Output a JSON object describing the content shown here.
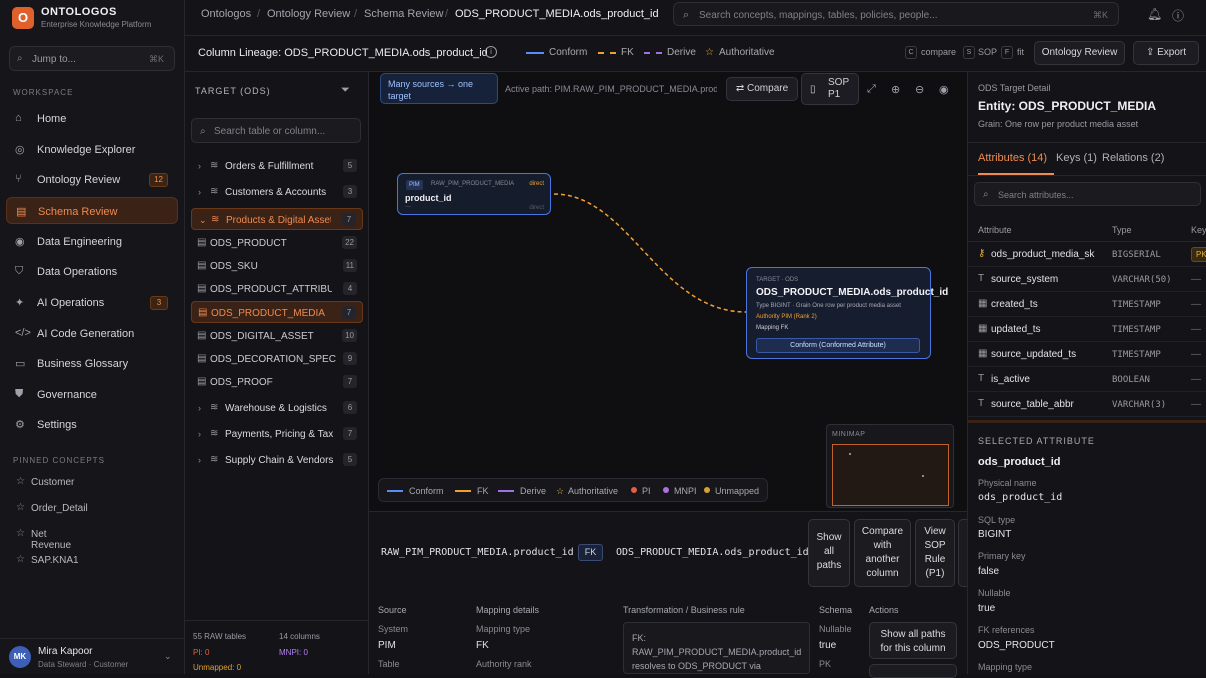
{
  "app": {
    "name": "ONTOLOGOS",
    "subtitle": "Enterprise Knowledge Platform",
    "logo_glyph": "O"
  },
  "jump": {
    "label": "Jump to...",
    "shortcut": "⌘K"
  },
  "sidebar": {
    "workspace_label": "WORKSPACE",
    "items": [
      {
        "label": "Home",
        "icon": "home-icon"
      },
      {
        "label": "Knowledge Explorer",
        "icon": "compass-icon"
      },
      {
        "label": "Ontology Review",
        "icon": "graph-icon",
        "badge": "12"
      },
      {
        "label": "Schema Review",
        "icon": "table-icon",
        "active": true
      },
      {
        "label": "Data Engineering",
        "icon": "database-icon"
      },
      {
        "label": "Data Operations",
        "icon": "shield-icon"
      },
      {
        "label": "AI Operations",
        "icon": "sparkle-icon",
        "badge": "3"
      },
      {
        "label": "AI Code Generation",
        "icon": "code-icon"
      },
      {
        "label": "Business Glossary",
        "icon": "book-icon"
      },
      {
        "label": "Governance",
        "icon": "shield-check-icon"
      },
      {
        "label": "Settings",
        "icon": "gear-icon"
      }
    ],
    "pinned_label": "PINNED CONCEPTS",
    "pinned": [
      "Customer",
      "Order_Detail",
      "Net Revenue",
      "SAP.KNA1"
    ]
  },
  "user": {
    "initials": "MK",
    "name": "Mira Kapoor",
    "role": "Data Steward · Customer"
  },
  "breadcrumb": [
    "Ontologos",
    "Ontology Review",
    "Schema Review",
    "ODS_PRODUCT_MEDIA.ods_product_id"
  ],
  "search": {
    "placeholder": "Search concepts, mappings, tables, policies, people...",
    "shortcut": "⌘K"
  },
  "lineage_header": {
    "title": "Column Lineage: ODS_PRODUCT_MEDIA.ods_product_id",
    "legend": [
      "Conform",
      "FK",
      "Derive",
      "Authoritative"
    ],
    "shortcuts": [
      {
        "key": "C",
        "label": "compare"
      },
      {
        "key": "S",
        "label": "SOP"
      },
      {
        "key": "F",
        "label": "fit"
      }
    ],
    "buttons": [
      "Ontology Review",
      "Export"
    ]
  },
  "tree": {
    "header": "TARGET (ODS)",
    "search_placeholder": "Search table or column...",
    "groups": [
      {
        "label": "Orders & Fulfillment",
        "count": "5"
      },
      {
        "label": "Customers & Accounts",
        "count": "3"
      },
      {
        "label": "Products & Digital Assets",
        "count": "7",
        "expanded": true
      }
    ],
    "tables": [
      {
        "label": "ODS_PRODUCT",
        "count": "22"
      },
      {
        "label": "ODS_SKU",
        "count": "11"
      },
      {
        "label": "ODS_PRODUCT_ATTRIBUTE",
        "count": "4"
      },
      {
        "label": "ODS_PRODUCT_MEDIA",
        "count": "7",
        "selected": true
      },
      {
        "label": "ODS_DIGITAL_ASSET",
        "count": "10"
      },
      {
        "label": "ODS_DECORATION_SPEC",
        "count": "9"
      },
      {
        "label": "ODS_PROOF",
        "count": "7"
      }
    ],
    "groups_after": [
      {
        "label": "Warehouse & Logistics",
        "count": "6"
      },
      {
        "label": "Payments, Pricing & Tax",
        "count": "7"
      },
      {
        "label": "Supply Chain & Vendors",
        "count": "5"
      }
    ],
    "stats": {
      "raw_tables": "55 RAW tables",
      "columns": "14 columns",
      "pi": "PI: 0",
      "mnpi": "MNPI: 0",
      "unmapped": "Unmapped: 0"
    }
  },
  "canvas": {
    "tooltip": "Many sources → one target",
    "active_path": "Active path: PIM.RAW_PIM_PRODUCT_MEDIA.product_id",
    "compare_label": "Compare",
    "sop_label": "SOP P1",
    "source_node": {
      "system": "PIM",
      "table": "RAW_PIM_PRODUCT_MEDIA",
      "column": "product_id",
      "tag": "direct",
      "sub": "direct",
      "dash": "—"
    },
    "target_node": {
      "eyebrow": "TARGET · ODS",
      "title": "ODS_PRODUCT_MEDIA.ods_product_id",
      "line1": "Type BIGINT · Grain One row per product media asset",
      "line2": "Authority PIM (Rank 2)",
      "line3": "Mapping FK",
      "button": "Conform (Conformed Attribute)"
    },
    "minimap_label": "MINIMAP",
    "legend": [
      {
        "label": "Conform",
        "color": "#5b8cf5"
      },
      {
        "label": "FK",
        "color": "#f0a030"
      },
      {
        "label": "Derive",
        "color": "#a070e8"
      },
      {
        "label": "Authoritative",
        "color": "#e0b040"
      },
      {
        "label": "PI",
        "color": "#e06040"
      },
      {
        "label": "MNPI",
        "color": "#b070e0"
      },
      {
        "label": "Unmapped",
        "color": "#d8a030"
      }
    ]
  },
  "detail": {
    "source_col": "RAW_PIM_PRODUCT_MEDIA.product_id",
    "rel": "FK",
    "target_col": "ODS_PRODUCT_MEDIA.ods_product_id",
    "buttons": [
      "Show all paths",
      "Compare with another column",
      "View SOP Rule (P1)"
    ],
    "cols": {
      "source": "Source",
      "system_l": "System",
      "system_v": "PIM",
      "table_l": "Table",
      "mapping": "Mapping details",
      "mtype_l": "Mapping type",
      "mtype_v": "FK",
      "arank_l": "Authority rank",
      "transform": "Transformation / Business rule",
      "transform_text": "FK: RAW_PIM_PRODUCT_MEDIA.product_id resolves to ODS_PRODUCT via",
      "schema": "Schema",
      "nullable_l": "Nullable",
      "nullable_v": "true",
      "pk_l": "PK",
      "actions": "Actions",
      "action_btn": "Show all paths for this column"
    }
  },
  "rpanel": {
    "eyebrow": "ODS Target Detail",
    "entity": "Entity: ODS_PRODUCT_MEDIA",
    "grain": "Grain: One row per product media asset",
    "tabs": [
      "Attributes (14)",
      "Keys (1)",
      "Relations (2)"
    ],
    "search_placeholder": "Search attributes...",
    "cols": [
      "Attribute",
      "Type",
      "Key"
    ],
    "rows": [
      {
        "name": "ods_product_media_sk",
        "type": "BIGSERIAL",
        "key": "PK",
        "icon": "key-icon"
      },
      {
        "name": "source_system",
        "type": "VARCHAR(50)",
        "key": "—",
        "icon": "text-icon"
      },
      {
        "name": "created_ts",
        "type": "TIMESTAMP",
        "key": "—",
        "icon": "calendar-icon"
      },
      {
        "name": "updated_ts",
        "type": "TIMESTAMP",
        "key": "—",
        "icon": "calendar-icon"
      },
      {
        "name": "source_updated_ts",
        "type": "TIMESTAMP",
        "key": "—",
        "icon": "calendar-icon"
      },
      {
        "name": "is_active",
        "type": "BOOLEAN",
        "key": "—",
        "icon": "text-icon"
      },
      {
        "name": "source_table_abbr",
        "type": "VARCHAR(3)",
        "key": "—",
        "icon": "text-icon"
      }
    ],
    "selected": {
      "header": "SELECTED ATTRIBUTE",
      "name": "ods_product_id",
      "fields": [
        {
          "label": "Physical name",
          "value": "ods_product_id"
        },
        {
          "label": "SQL type",
          "value": "BIGINT"
        },
        {
          "label": "Primary key",
          "value": "false"
        },
        {
          "label": "Nullable",
          "value": "true"
        },
        {
          "label": "FK references",
          "value": "ODS_PRODUCT"
        },
        {
          "label": "Mapping type",
          "value": ""
        }
      ]
    }
  }
}
